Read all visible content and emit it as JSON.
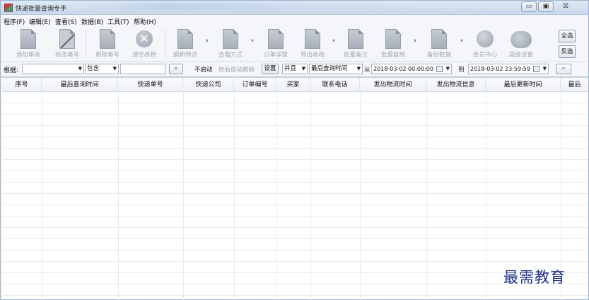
{
  "window": {
    "title": "快递批量查询专手",
    "controls": {
      "minimize": "▭",
      "maximize": "▣",
      "close": "⛝"
    }
  },
  "menu": [
    "程序(F)",
    "编辑(E)",
    "查看(S)",
    "数据(B)",
    "工具(T)",
    "帮助(H)"
  ],
  "toolbar": {
    "buttons": [
      {
        "label": "添加单号",
        "icon": "add-doc-icon"
      },
      {
        "label": "修改单号",
        "icon": "edit-pencil-icon"
      },
      {
        "label": "删除单号",
        "icon": "delete-doc-icon"
      },
      {
        "label": "清空表格",
        "icon": "clear-x-icon"
      },
      {
        "label": "刷新物流",
        "icon": "refresh-doc-icon"
      },
      {
        "label": "查看方式",
        "icon": "view-doc-icon"
      },
      {
        "label": "订单详情",
        "icon": "order-doc-icon"
      },
      {
        "label": "导出表格",
        "icon": "export-doc-icon"
      },
      {
        "label": "批量备注",
        "icon": "note-doc-icon"
      },
      {
        "label": "批量复制",
        "icon": "copy-doc-icon"
      },
      {
        "label": "备份数据",
        "icon": "backup-doc-icon"
      },
      {
        "label": "会员中心",
        "icon": "clock-icon"
      },
      {
        "label": "高级设置",
        "icon": "settings-blob-icon"
      }
    ],
    "select_all": "全选",
    "invert": "反选"
  },
  "filter": {
    "basis_label": "根据:",
    "basis_value": "",
    "contains_value": "包含",
    "keyword_value": "",
    "not_started": "不启动",
    "auto_refresh": "秒后自动刷新",
    "settings": "设置",
    "and_value": "并且",
    "time_field_value": "最后查询时间",
    "from_label": "从",
    "from_value": "2018-03-02 00:00:00",
    "to_label": "到",
    "to_value": "2018-03-02 23:59:59"
  },
  "table": {
    "columns": [
      "序号",
      "最后查询时间",
      "快递单号",
      "快递公司",
      "订单编号",
      "买家",
      "联系电话",
      "发出物流时间",
      "发出物流信息",
      "最后更新时间",
      "最后"
    ]
  },
  "watermark": "最需教育"
}
